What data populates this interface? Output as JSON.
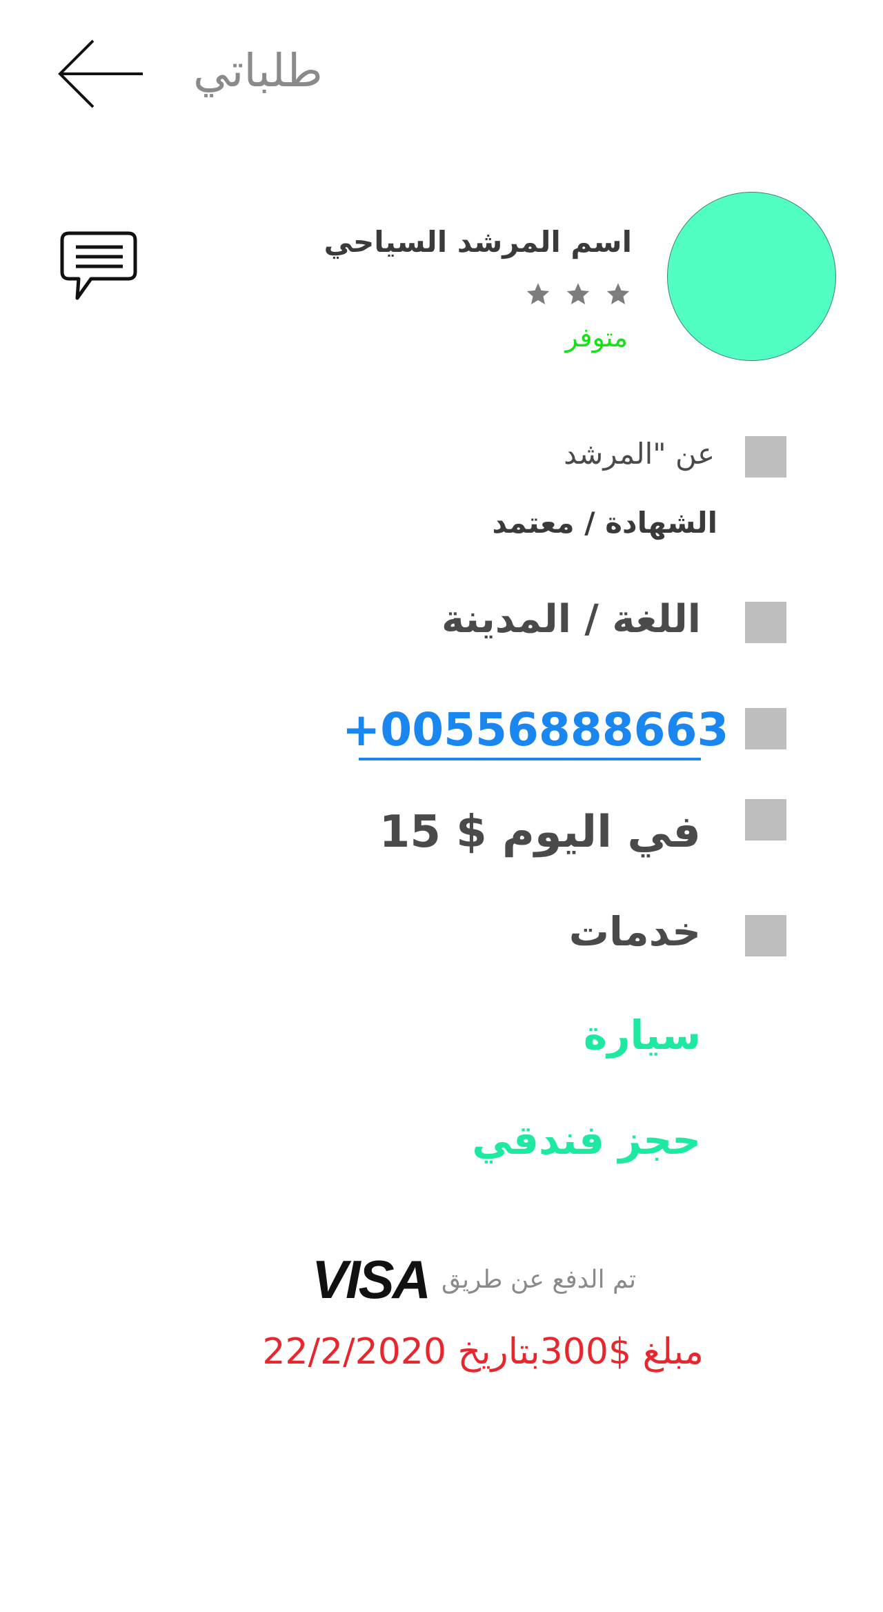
{
  "header": {
    "title": "طلباتي",
    "back_icon": "arrow-left-icon"
  },
  "guide": {
    "name": "اسم المرشد السياحي",
    "rating_stars": 3,
    "availability": "متوفر",
    "avatar_color": "#52ffc2",
    "chat_icon": "chat-bubble-icon"
  },
  "details": {
    "about": "عن \"المرشد",
    "certificate": "الشهادة / معتمد",
    "language_city": "اللغة / المدينة",
    "phone": "+00556888663",
    "price": "في اليوم $ 15",
    "services_label": "خدمات",
    "services": [
      "سيارة",
      "حجز فندقي"
    ]
  },
  "payment": {
    "paid_via": "تم الدفع عن طريق",
    "method": "VISA",
    "amount_line": "مبلغ  $300بتاريخ 22/2/2020"
  },
  "colors": {
    "accent_green": "#1ee9a0",
    "available_green": "#16e016",
    "link_blue": "#1a86f0",
    "amount_red": "#e8262e"
  }
}
